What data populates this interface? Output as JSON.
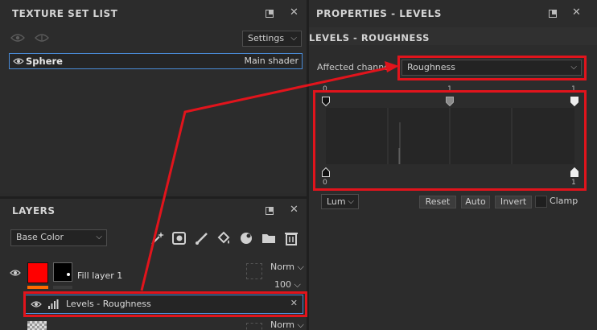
{
  "texture_set_list": {
    "title": "TEXTURE SET LIST",
    "settings_label": "Settings",
    "item": {
      "name": "Sphere",
      "shader": "Main shader"
    }
  },
  "layers": {
    "title": "LAYERS",
    "channel": "Base Color",
    "fill_layer": {
      "name": "Fill layer 1",
      "blend": "Norm",
      "opacity": "100"
    },
    "levels_layer": {
      "name": "Levels - Roughness"
    },
    "next_layer": {
      "blend": "Norm"
    }
  },
  "properties": {
    "title": "PROPERTIES - LEVELS",
    "subtitle": "LEVELS - ROUGHNESS",
    "affected_channel_label": "Affected channel",
    "affected_channel_value": "Roughness",
    "levels": {
      "top_left": "0",
      "top_mid": "1",
      "top_right": "1",
      "bottom_left": "0",
      "bottom_right": "1"
    },
    "mode": "Lum",
    "reset_label": "Reset",
    "auto_label": "Auto",
    "invert_label": "Invert",
    "clamp_label": "Clamp"
  },
  "colors": {
    "highlight": "#e1141c",
    "fill_swatch": "#ff0000",
    "selected_border": "#4a8bd6"
  }
}
